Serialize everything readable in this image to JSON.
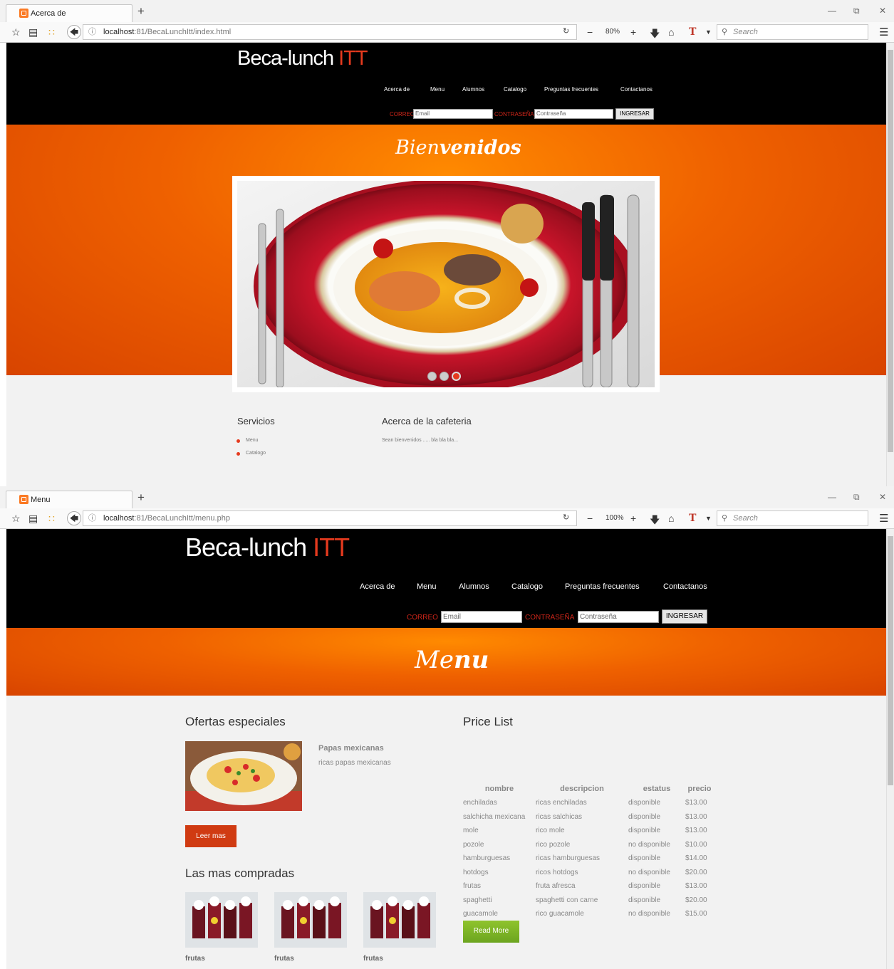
{
  "win1": {
    "tab_title": "Acerca de",
    "url_host": "localhost",
    "url_rest": ":81/BecaLunchItt/index.html",
    "zoom": "80%",
    "search_placeholder": "Search",
    "site": {
      "logo_main": "Beca-lunch ",
      "logo_accent": "ITT",
      "nav": [
        "Acerca de",
        "Menu",
        "Alumnos",
        "Catalogo",
        "Preguntas frecuentes",
        "Contactanos"
      ],
      "correo_label": "CORREO",
      "email_placeholder": "Email",
      "pass_label": "CONTRASEÑA",
      "pass_placeholder": "Contraseña",
      "login_button": "INGRESAR",
      "banner_title_light": "Bien",
      "banner_title_bold": "venidos",
      "services_title": "Servicios",
      "services": [
        "Menu",
        "Catalogo"
      ],
      "about_title": "Acerca de la cafeteria",
      "about_text": "Sean bienvenidos ..... bla bla bla..."
    }
  },
  "win2": {
    "tab_title": "Menu",
    "url_host": "localhost",
    "url_rest": ":81/BecaLunchItt/menu.php",
    "zoom": "100%",
    "search_placeholder": "Search",
    "site": {
      "logo_main": "Beca-lunch ",
      "logo_accent": "ITT",
      "nav": [
        "Acerca de",
        "Menu",
        "Alumnos",
        "Catalogo",
        "Preguntas frecuentes",
        "Contactanos"
      ],
      "correo_label": "CORREO",
      "email_placeholder": "Email",
      "pass_label": "CONTRASEÑA",
      "pass_placeholder": "Contraseña",
      "login_button": "INGRESAR",
      "banner_title_light": "Me",
      "banner_title_bold": "nu",
      "offers_title": "Ofertas especiales",
      "offer_name": "Papas mexicanas",
      "offer_desc": "ricas papas mexicanas",
      "read_more_red": "Leer mas",
      "top_title": "Las mas compradas",
      "top_items": [
        "frutas",
        "frutas",
        "frutas"
      ],
      "price_title": "Price List",
      "price_headers": [
        "nombre",
        "descripcion",
        "estatus",
        "precio"
      ],
      "price_rows": [
        [
          "enchiladas",
          "ricas enchiladas",
          "disponible",
          "$13.00"
        ],
        [
          "salchicha mexicana",
          "ricas salchicas",
          "disponible",
          "$13.00"
        ],
        [
          "mole",
          "rico mole",
          "disponible",
          "$13.00"
        ],
        [
          "pozole",
          "rico pozole",
          "no disponible",
          "$10.00"
        ],
        [
          "hamburguesas",
          "ricas hamburguesas",
          "disponible",
          "$14.00"
        ],
        [
          "hotdogs",
          "ricos hotdogs",
          "no disponible",
          "$20.00"
        ],
        [
          "frutas",
          "fruta afresca",
          "disponible",
          "$13.00"
        ],
        [
          "spaghetti",
          "spaghetti con carne",
          "disponible",
          "$20.00"
        ],
        [
          "guacamole",
          "rico guacamole",
          "no disponible",
          "$15.00"
        ]
      ],
      "read_more_green": "Read More"
    }
  },
  "colors": {
    "accent": "#e53a1e",
    "banner": "#ef6100",
    "green": "#7ab426"
  }
}
